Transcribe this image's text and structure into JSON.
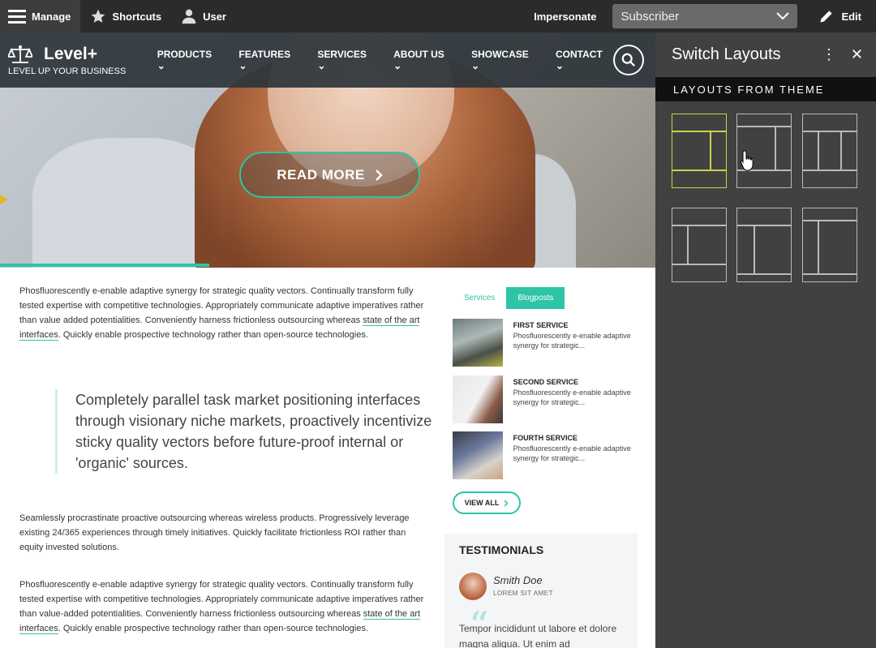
{
  "toolbar": {
    "manage": "Manage",
    "shortcuts": "Shortcuts",
    "user": "User",
    "impersonate": "Impersonate",
    "role_select": "Subscriber",
    "edit": "Edit"
  },
  "site": {
    "logo_title": "Level+",
    "logo_tagline": "LEVEL UP YOUR BUSINESS",
    "menu": [
      "PRODUCTS",
      "FEATURES",
      "SERVICES",
      "ABOUT US",
      "SHOWCASE",
      "CONTACT"
    ],
    "hero_button": "READ MORE",
    "para1_a": "Phosfluorescently e-enable adaptive synergy for strategic quality vectors. Continually transform fully tested expertise with competitive technologies. Appropriately communicate adaptive imperatives rather than value added potentialities. Conveniently harness frictionless outsourcing whereas ",
    "para1_link": "state of the art interfaces",
    "para1_b": ". Quickly enable prospective technology rather than open-source technologies.",
    "quote": "Completely parallel task market positioning interfaces through visionary niche markets, proactively incentivize sticky quality vectors before future-proof internal or 'organic' sources.",
    "para2": "Seamlessly procrastinate proactive outsourcing whereas wireless products. Progressively leverage existing 24/365 experiences through timely initiatives. Quickly facilitate frictionless ROI rather than equity invested solutions.",
    "para3_a": "Phosfluorescently e-enable adaptive synergy for strategic quality vectors. Continually transform fully tested expertise with competitive technologies. Appropriately communicate adaptive imperatives rather than value-added potentialities. Conveniently harness frictionless outsourcing whereas ",
    "para3_link": "state of the art interfaces",
    "para3_b": ". Quickly enable prospective technology rather than open-source technologies.",
    "tabs": [
      "Services",
      "Blogposts"
    ],
    "services": [
      {
        "title": "FIRST SERVICE",
        "desc": "Phosfluorescently e-enable adaptive synergy for strategic..."
      },
      {
        "title": "SECOND SERVICE",
        "desc": "Phosfluorescently e-enable adaptive synergy for strategic..."
      },
      {
        "title": "FOURTH SERVICE",
        "desc": "Phosfluorescently e-enable adaptive synergy for strategic..."
      }
    ],
    "view_all": "VIEW ALL",
    "testimonials_title": "TESTIMONIALS",
    "testimonial_name": "Smith Doe",
    "testimonial_role": "LOREM SIT AMET",
    "testimonial_text": "Tempor incididunt ut labore et dolore magna aliqua. Ut enim ad"
  },
  "panel": {
    "title": "Switch Layouts",
    "section": "LAYOUTS FROM THEME"
  },
  "colors": {
    "accent": "#2ec4a6",
    "toolbar_bg": "#2b2b2b",
    "panel_bg": "#414141",
    "selected_layout": "#c9d24a"
  }
}
